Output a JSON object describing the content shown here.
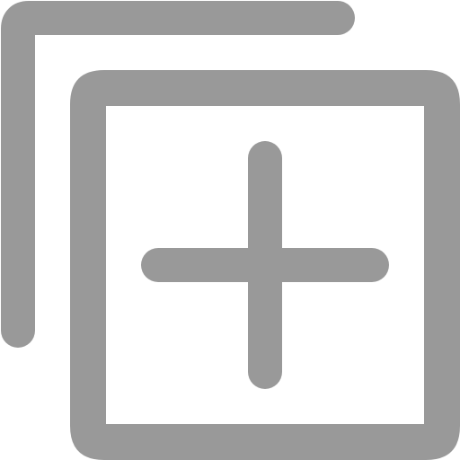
{
  "icon": {
    "name": "add-to-collection-icon",
    "stroke_color": "#999999",
    "background_color": "#ffffff"
  }
}
